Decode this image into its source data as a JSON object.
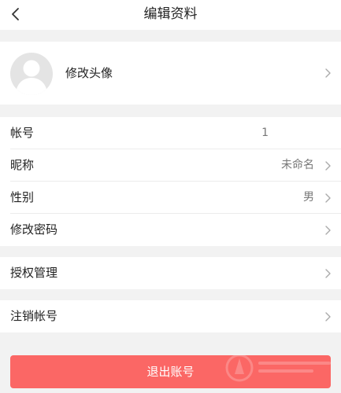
{
  "header": {
    "title": "编辑资料",
    "back_icon": "chevron-left-icon"
  },
  "avatar": {
    "label": "修改头像"
  },
  "account_rows": [
    {
      "label": "帐号",
      "value": "1"
    },
    {
      "label": "昵称",
      "value": "未命名"
    },
    {
      "label": "性别",
      "value": "男"
    },
    {
      "label": "修改密码",
      "value": ""
    }
  ],
  "auth": {
    "label": "授权管理"
  },
  "deactivate": {
    "label": "注销帐号"
  },
  "logout": {
    "label": "退出账号"
  },
  "colors": {
    "accent": "#fb6765",
    "background": "#f2f2f2"
  }
}
